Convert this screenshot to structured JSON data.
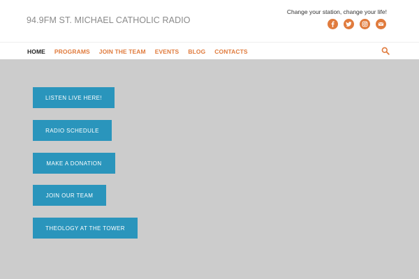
{
  "site": {
    "title": "94.9FM ST. MICHAEL CATHOLIC RADIO",
    "tagline": "Change your station, change your life!"
  },
  "social": {
    "icons": [
      "facebook-icon",
      "twitter-icon",
      "instagram-icon",
      "email-icon"
    ],
    "color": "#e07b3d"
  },
  "nav": {
    "items": [
      {
        "label": "HOME",
        "active": true
      },
      {
        "label": "PROGRAMS",
        "active": false
      },
      {
        "label": "JOIN THE TEAM",
        "active": false
      },
      {
        "label": "EVENTS",
        "active": false
      },
      {
        "label": "BLOG",
        "active": false
      },
      {
        "label": "CONTACTS",
        "active": false
      }
    ],
    "accent": "#e07b3d",
    "search_icon": "search-icon"
  },
  "buttons": {
    "listen_live": "LISTEN LIVE HERE!",
    "radio_schedule": "RADIO SCHEDULE",
    "make_donation": "MAKE A DONATION",
    "join_team": "JOIN OUR TEAM",
    "theology_tower": "THEOLOGY AT THE TOWER",
    "color": "#2a95bc"
  },
  "page": {
    "background": "#cccccc"
  }
}
